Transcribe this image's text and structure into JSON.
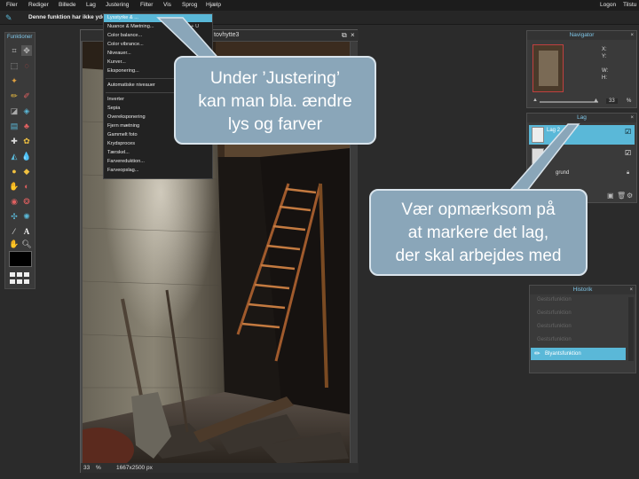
{
  "menubar": {
    "items": [
      "Filer",
      "Rediger",
      "Billede",
      "Lag",
      "Justering",
      "Filter",
      "Vis",
      "Sprog",
      "Hjælp"
    ],
    "login": "Logon",
    "signup": "Tilstu"
  },
  "optionsbar": {
    "message": "Denne funktion har ikke ydel"
  },
  "tools": {
    "title": "Funktioner"
  },
  "document": {
    "title": "tovhytte3",
    "zoom": "33",
    "zoom_unit": "%",
    "size": "1667x2500 px"
  },
  "dropdown": {
    "items": [
      {
        "label": "Lysstyrke & ...",
        "shortcut": ""
      },
      {
        "label": "Nuance & Mætning...",
        "shortcut": "Ctrl + U"
      },
      {
        "label": "Color balance...",
        "shortcut": ""
      },
      {
        "label": "Color vibrance...",
        "shortcut": ""
      },
      {
        "label": "Niveauer...",
        "shortcut": ""
      },
      {
        "label": "Kurver...",
        "shortcut": ""
      },
      {
        "label": "Eksponering...",
        "shortcut": ""
      },
      {
        "label": "Automatiske niveauer",
        "shortcut": ""
      },
      {
        "label": "Inverter",
        "shortcut": ""
      },
      {
        "label": "Sepia",
        "shortcut": ""
      },
      {
        "label": "Overeksponering",
        "shortcut": ""
      },
      {
        "label": "Fjern mætning",
        "shortcut": ""
      },
      {
        "label": "Gammelt foto",
        "shortcut": ""
      },
      {
        "label": "Krydsproces",
        "shortcut": ""
      },
      {
        "label": "Tærskel...",
        "shortcut": ""
      },
      {
        "label": "Farvereduktion...",
        "shortcut": ""
      },
      {
        "label": "Farveopslag...",
        "shortcut": ""
      }
    ]
  },
  "navigator": {
    "title": "Navigator",
    "x_label": "X:",
    "y_label": "Y:",
    "w_label": "W:",
    "h_label": "H:",
    "zoom": "33",
    "zoom_unit": "%"
  },
  "layers": {
    "title": "Lag",
    "items": [
      {
        "name": "Lag 2",
        "selected": true
      },
      {
        "name": "La",
        "selected": false
      },
      {
        "name": "grund",
        "selected": false
      }
    ]
  },
  "history": {
    "title": "Historik",
    "items": [
      "Gestsrfunktion",
      "Gestsrfunktion",
      "Gestsrfunktion",
      "Gestsrfunktion"
    ],
    "active": "Blyantsfunktion"
  },
  "callouts": {
    "top": [
      "Under ’Justering’",
      "kan man bla. ændre",
      "lys og farver"
    ],
    "right": [
      "Vær opmærksom på",
      "at markere det lag,",
      "der skal arbejdes med"
    ]
  },
  "colors": {
    "accent": "#5ab8d8",
    "callout": "#8aa6b9",
    "panel_header": "#7fc6e8"
  }
}
